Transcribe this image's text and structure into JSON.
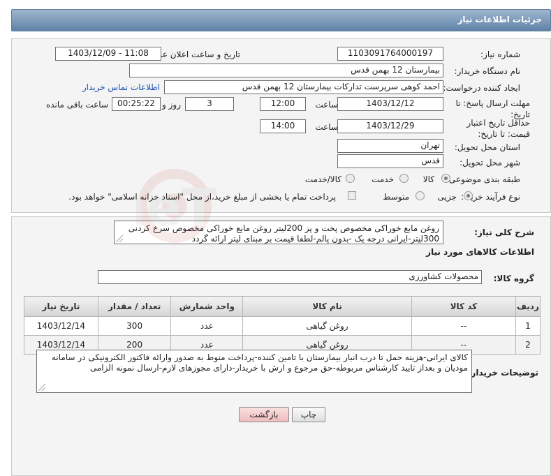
{
  "header": {
    "title": "جزئیات اطلاعات نیاز"
  },
  "form": {
    "need_number": {
      "label": "شماره نیاز:",
      "value": "1103091764000197"
    },
    "announce": {
      "label": "تاریخ و ساعت اعلان عمومی:",
      "value": "1403/12/09 - 11:08"
    },
    "buyer_org": {
      "label": "نام دستگاه خریدار:",
      "value": "بیمارستان 12 بهمن قدس"
    },
    "creator": {
      "label": "ایجاد کننده درخواست:",
      "value": "احمد کوهی سرپرست تدارکات بیمارستان 12 بهمن قدس",
      "contact_link": "اطلاعات تماس خریدار"
    },
    "reply_deadline": {
      "label": "مهلت ارسال پاسخ: تا تاریخ:",
      "date": "1403/12/12",
      "time_label": "ساعت",
      "time": "12:00",
      "days": "3",
      "days_label": "روز و",
      "remaining": "00:25:22",
      "remaining_label": "ساعت باقی مانده"
    },
    "price_validity": {
      "label": "حداقل تاریخ اعتبار قیمت: تا تاریخ:",
      "date": "1403/12/29",
      "time_label": "ساعت",
      "time": "14:00"
    },
    "province": {
      "label": "استان محل تحویل:",
      "value": "تهران"
    },
    "city": {
      "label": "شهر محل تحویل:",
      "value": "قدس"
    },
    "category": {
      "label": "طبقه بندی موضوعی:",
      "options": [
        "کالا",
        "خدمت",
        "کالا/خدمت"
      ],
      "selected": "کالا"
    },
    "process": {
      "label": "نوع فرآیند خرید :",
      "options": [
        "جزیی",
        "متوسط"
      ],
      "selected": "جزیی",
      "payment_note": "پرداخت تمام یا بخشی از مبلغ خرید،از محل \"اسناد خزانه اسلامی\" خواهد بود."
    }
  },
  "description": {
    "label": "شرح کلی نیاز:",
    "text": "روغن مایع خوراکی مخصوص پخت و پز 200لیتر روغن مایع خوراکی مخصوص سرخ کردنی 300لیتر-ایرانی درجه یک -بدون پالم-لطفا قیمت بر مبنای لیتر ارائه گردد"
  },
  "goods": {
    "section_title": "اطلاعات کالاهای مورد نیاز",
    "group_label": "گروه کالا:",
    "group_value": "محصولات کشاورزی",
    "columns": [
      "ردیف",
      "کد کالا",
      "نام کالا",
      "واحد شمارش",
      "تعداد / مقدار",
      "تاریخ نیاز"
    ],
    "rows": [
      {
        "row": "1",
        "code": "--",
        "name": "روغن گیاهی",
        "unit": "عدد",
        "qty": "300",
        "date": "1403/12/14"
      },
      {
        "row": "2",
        "code": "--",
        "name": "روغن گیاهی",
        "unit": "عدد",
        "qty": "200",
        "date": "1403/12/14"
      }
    ]
  },
  "buyer_notes": {
    "label": "توضیحات خریدار:",
    "text": "کالای ایرانی-هزینه حمل تا درب انبار بیمارستان با تامین کننده-پرداخت منوط به صدور وارائه فاکتور الکترونیکی در سامانه مودیان و بعداز تایید کارشناس مربوطه-حق مرجوع و ارش با خریدار-دارای مجوزهای لازم-ارسال نمونه الزامی"
  },
  "buttons": {
    "print": "چاپ",
    "back": "بازگشت"
  },
  "watermark": {
    "text": "AriaTender.neT"
  },
  "colors": {
    "header": "#6f8fb3",
    "link": "#1a50b5",
    "back_button": "#f3c6c6"
  }
}
